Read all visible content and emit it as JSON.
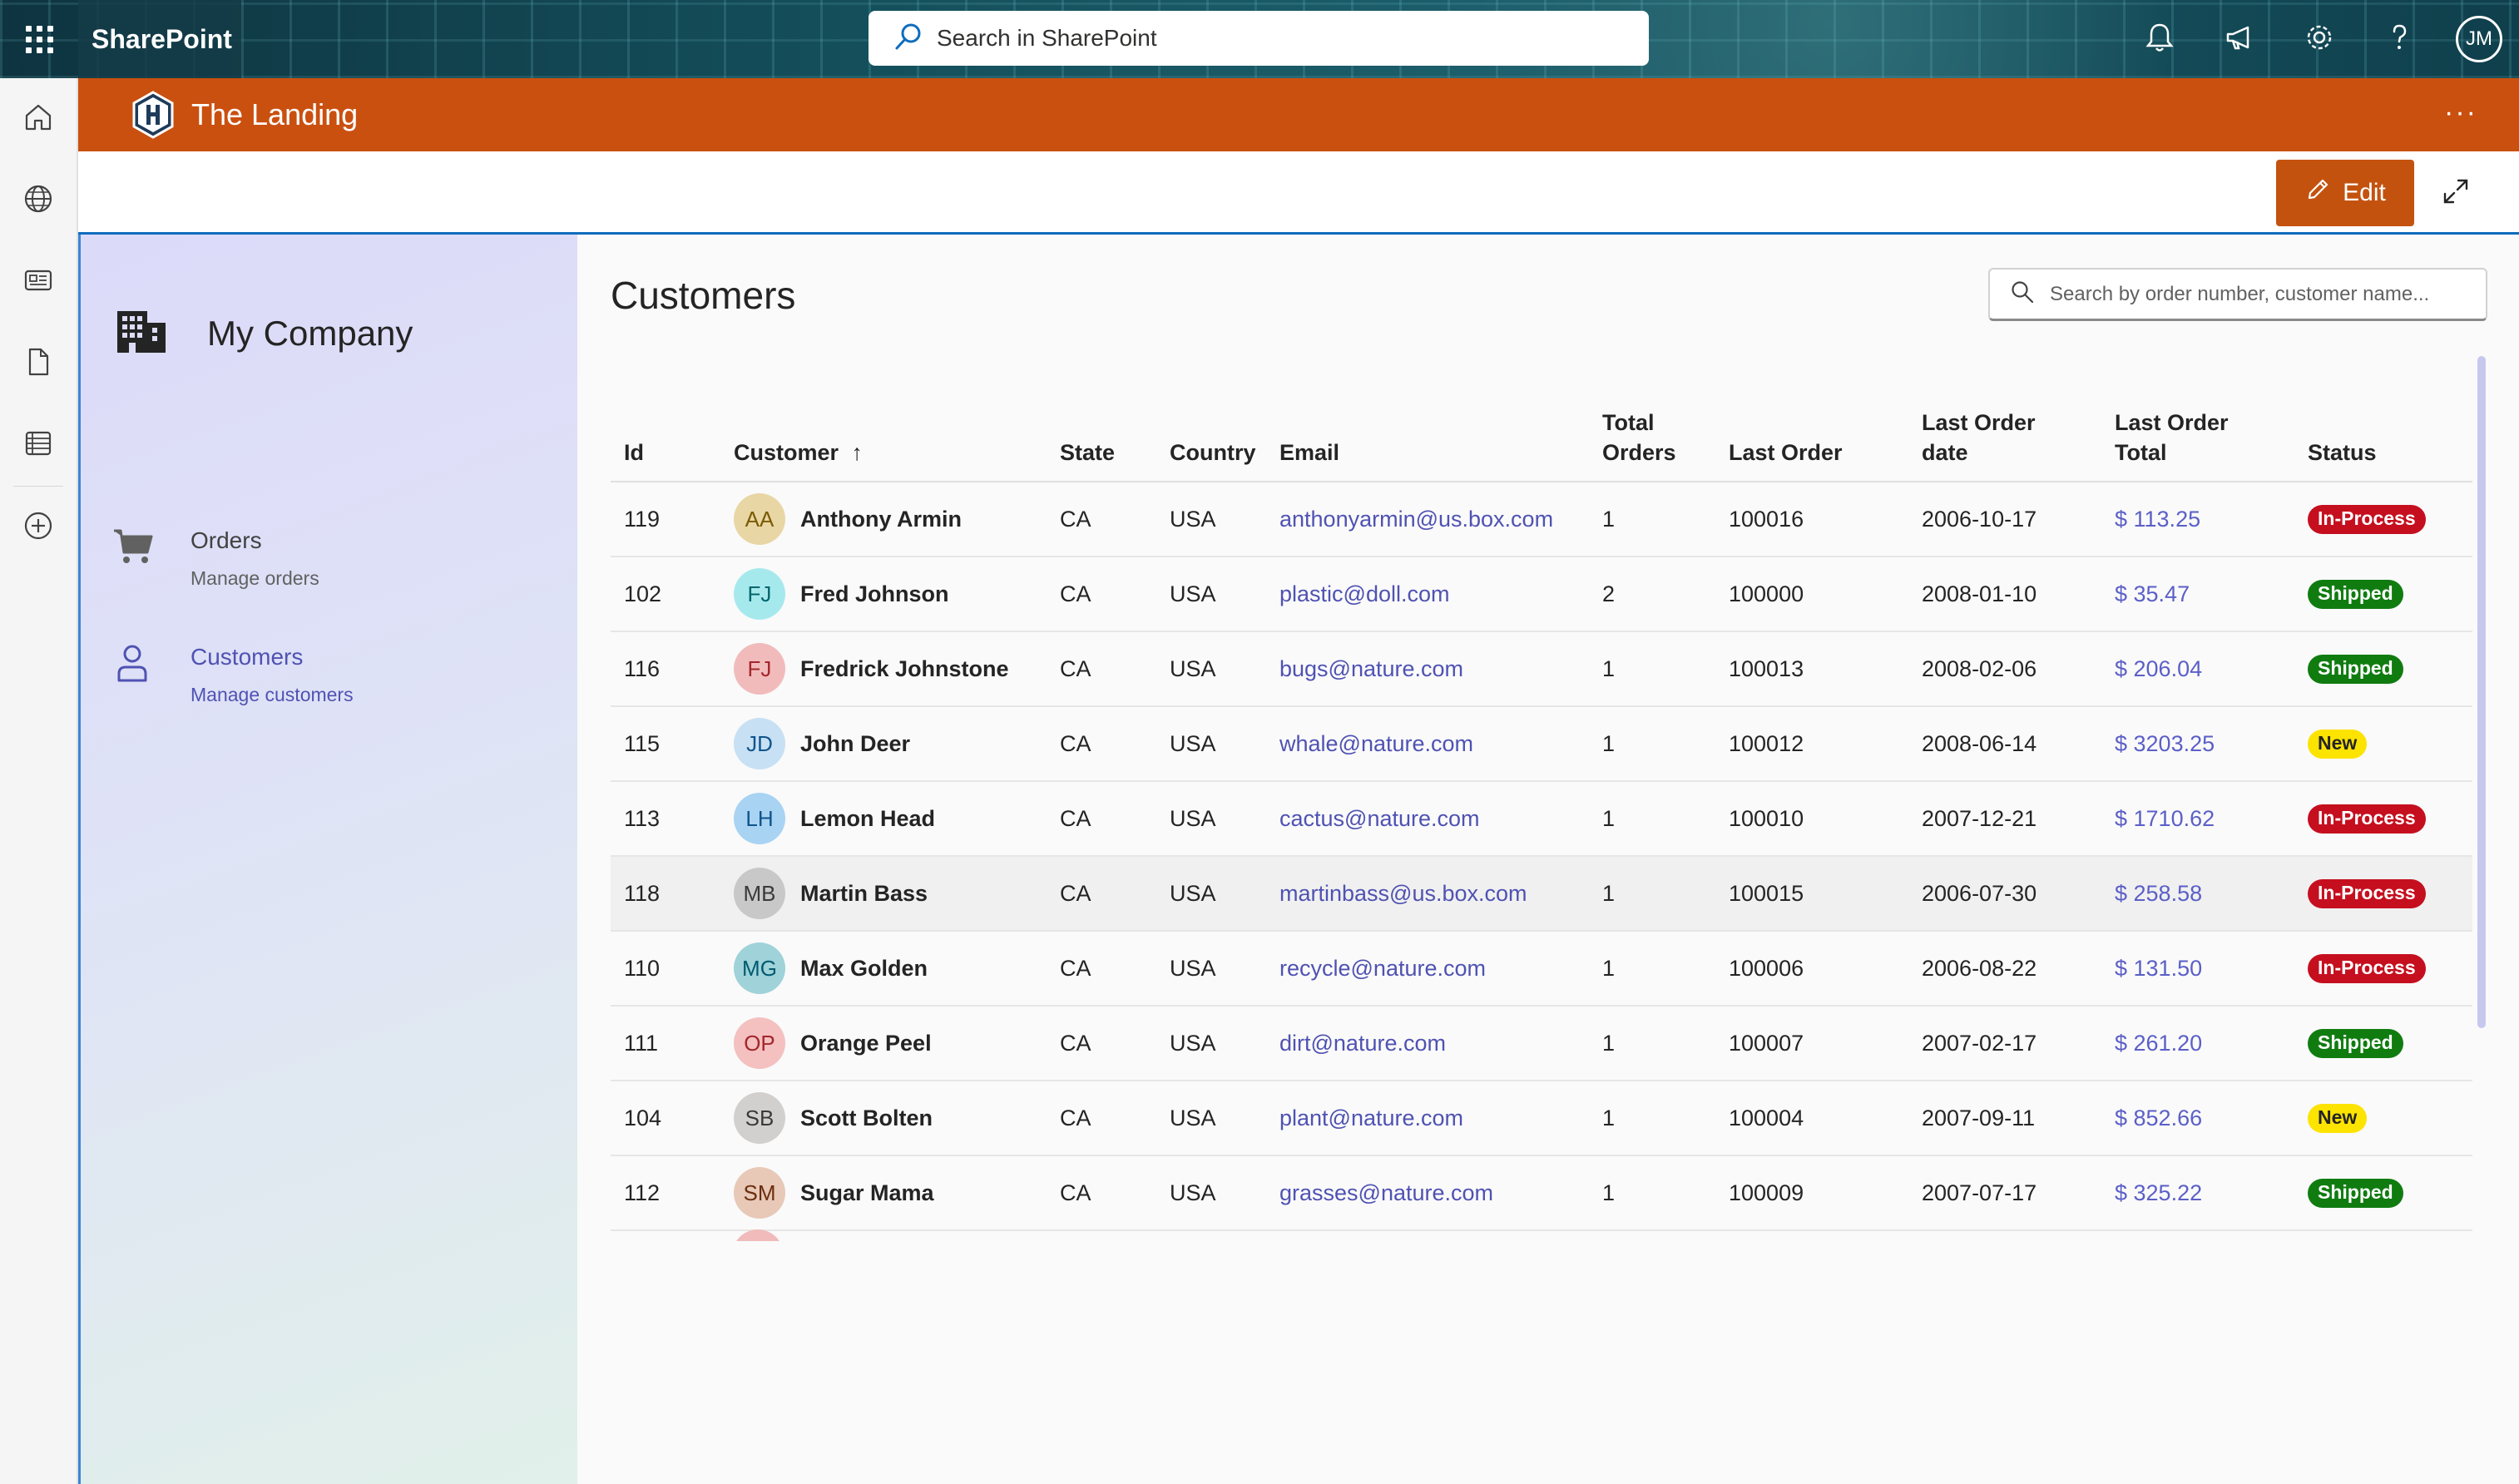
{
  "suitebar": {
    "brand": "SharePoint",
    "search_placeholder": "Search in SharePoint",
    "user_initials": "JM"
  },
  "site": {
    "title": "The Landing",
    "more": "···"
  },
  "command": {
    "edit_label": "Edit"
  },
  "nav": {
    "company": "My Company",
    "items": [
      {
        "label": "Orders",
        "sub": "Manage orders",
        "icon": "cart-icon",
        "active": false
      },
      {
        "label": "Customers",
        "sub": "Manage customers",
        "icon": "person-icon",
        "active": true
      }
    ]
  },
  "main": {
    "title": "Customers",
    "search_placeholder": "Search by order number, customer name...",
    "columns": {
      "id": "Id",
      "customer": "Customer",
      "state": "State",
      "country": "Country",
      "email": "Email",
      "total_orders_1": "Total",
      "total_orders_2": "Orders",
      "last_order": "Last Order",
      "last_order_date_1": "Last Order",
      "last_order_date_2": "date",
      "last_order_total_1": "Last Order",
      "last_order_total_2": "Total",
      "status": "Status"
    },
    "sort_indicator": "↑",
    "rows": [
      {
        "id": "119",
        "initials": "AA",
        "avatar_bg": "#e9d6a5",
        "avatar_fg": "#7a5b00",
        "customer": "Anthony Armin",
        "state": "CA",
        "country": "USA",
        "email": "anthonyarmin@us.box.com",
        "total_orders": "1",
        "last_order": "100016",
        "date": "2006-10-17",
        "total": "$ 113.25",
        "status": "In-Process",
        "status_kind": "inprocess"
      },
      {
        "id": "102",
        "initials": "FJ",
        "avatar_bg": "#a6e9ed",
        "avatar_fg": "#00666d",
        "customer": "Fred Johnson",
        "state": "CA",
        "country": "USA",
        "email": "plastic@doll.com",
        "total_orders": "2",
        "last_order": "100000",
        "date": "2008-01-10",
        "total": "$ 35.47",
        "status": "Shipped",
        "status_kind": "shipped"
      },
      {
        "id": "116",
        "initials": "FJ",
        "avatar_bg": "#f1bbbc",
        "avatar_fg": "#a4262c",
        "customer": "Fredrick Johnstone",
        "state": "CA",
        "country": "USA",
        "email": "bugs@nature.com",
        "total_orders": "1",
        "last_order": "100013",
        "date": "2008-02-06",
        "total": "$ 206.04",
        "status": "Shipped",
        "status_kind": "shipped"
      },
      {
        "id": "115",
        "initials": "JD",
        "avatar_bg": "#c7e0f4",
        "avatar_fg": "#0f548c",
        "customer": "John Deer",
        "state": "CA",
        "country": "USA",
        "email": "whale@nature.com",
        "total_orders": "1",
        "last_order": "100012",
        "date": "2008-06-14",
        "total": "$ 3203.25",
        "status": "New",
        "status_kind": "new"
      },
      {
        "id": "113",
        "initials": "LH",
        "avatar_bg": "#a9d3f2",
        "avatar_fg": "#0f548c",
        "customer": "Lemon Head",
        "state": "CA",
        "country": "USA",
        "email": "cactus@nature.com",
        "total_orders": "1",
        "last_order": "100010",
        "date": "2007-12-21",
        "total": "$ 1710.62",
        "status": "In-Process",
        "status_kind": "inprocess"
      },
      {
        "id": "118",
        "initials": "MB",
        "avatar_bg": "#c8c8c8",
        "avatar_fg": "#3b3a39",
        "customer": "Martin Bass",
        "state": "CA",
        "country": "USA",
        "email": "martinbass@us.box.com",
        "total_orders": "1",
        "last_order": "100015",
        "date": "2006-07-30",
        "total": "$ 258.58",
        "status": "In-Process",
        "status_kind": "inprocess"
      },
      {
        "id": "110",
        "initials": "MG",
        "avatar_bg": "#9fd2d9",
        "avatar_fg": "#005b70",
        "customer": "Max Golden",
        "state": "CA",
        "country": "USA",
        "email": "recycle@nature.com",
        "total_orders": "1",
        "last_order": "100006",
        "date": "2006-08-22",
        "total": "$ 131.50",
        "status": "In-Process",
        "status_kind": "inprocess"
      },
      {
        "id": "111",
        "initials": "OP",
        "avatar_bg": "#f4c0c0",
        "avatar_fg": "#a4262c",
        "customer": "Orange Peel",
        "state": "CA",
        "country": "USA",
        "email": "dirt@nature.com",
        "total_orders": "1",
        "last_order": "100007",
        "date": "2007-02-17",
        "total": "$ 261.20",
        "status": "Shipped",
        "status_kind": "shipped"
      },
      {
        "id": "104",
        "initials": "SB",
        "avatar_bg": "#d2d0ce",
        "avatar_fg": "#3b3a39",
        "customer": "Scott Bolten",
        "state": "CA",
        "country": "USA",
        "email": "plant@nature.com",
        "total_orders": "1",
        "last_order": "100004",
        "date": "2007-09-11",
        "total": "$ 852.66",
        "status": "New",
        "status_kind": "new"
      },
      {
        "id": "112",
        "initials": "SM",
        "avatar_bg": "#e8c8b7",
        "avatar_fg": "#6b2e0e",
        "customer": "Sugar Mama",
        "state": "CA",
        "country": "USA",
        "email": "grasses@nature.com",
        "total_orders": "1",
        "last_order": "100009",
        "date": "2007-07-17",
        "total": "$ 325.22",
        "status": "Shipped",
        "status_kind": "shipped"
      }
    ]
  },
  "colors": {
    "site_header": "#ca5010",
    "accent": "#4f52b2",
    "in_process": "#c50f1f",
    "shipped": "#107c10",
    "new": "#fde300"
  }
}
